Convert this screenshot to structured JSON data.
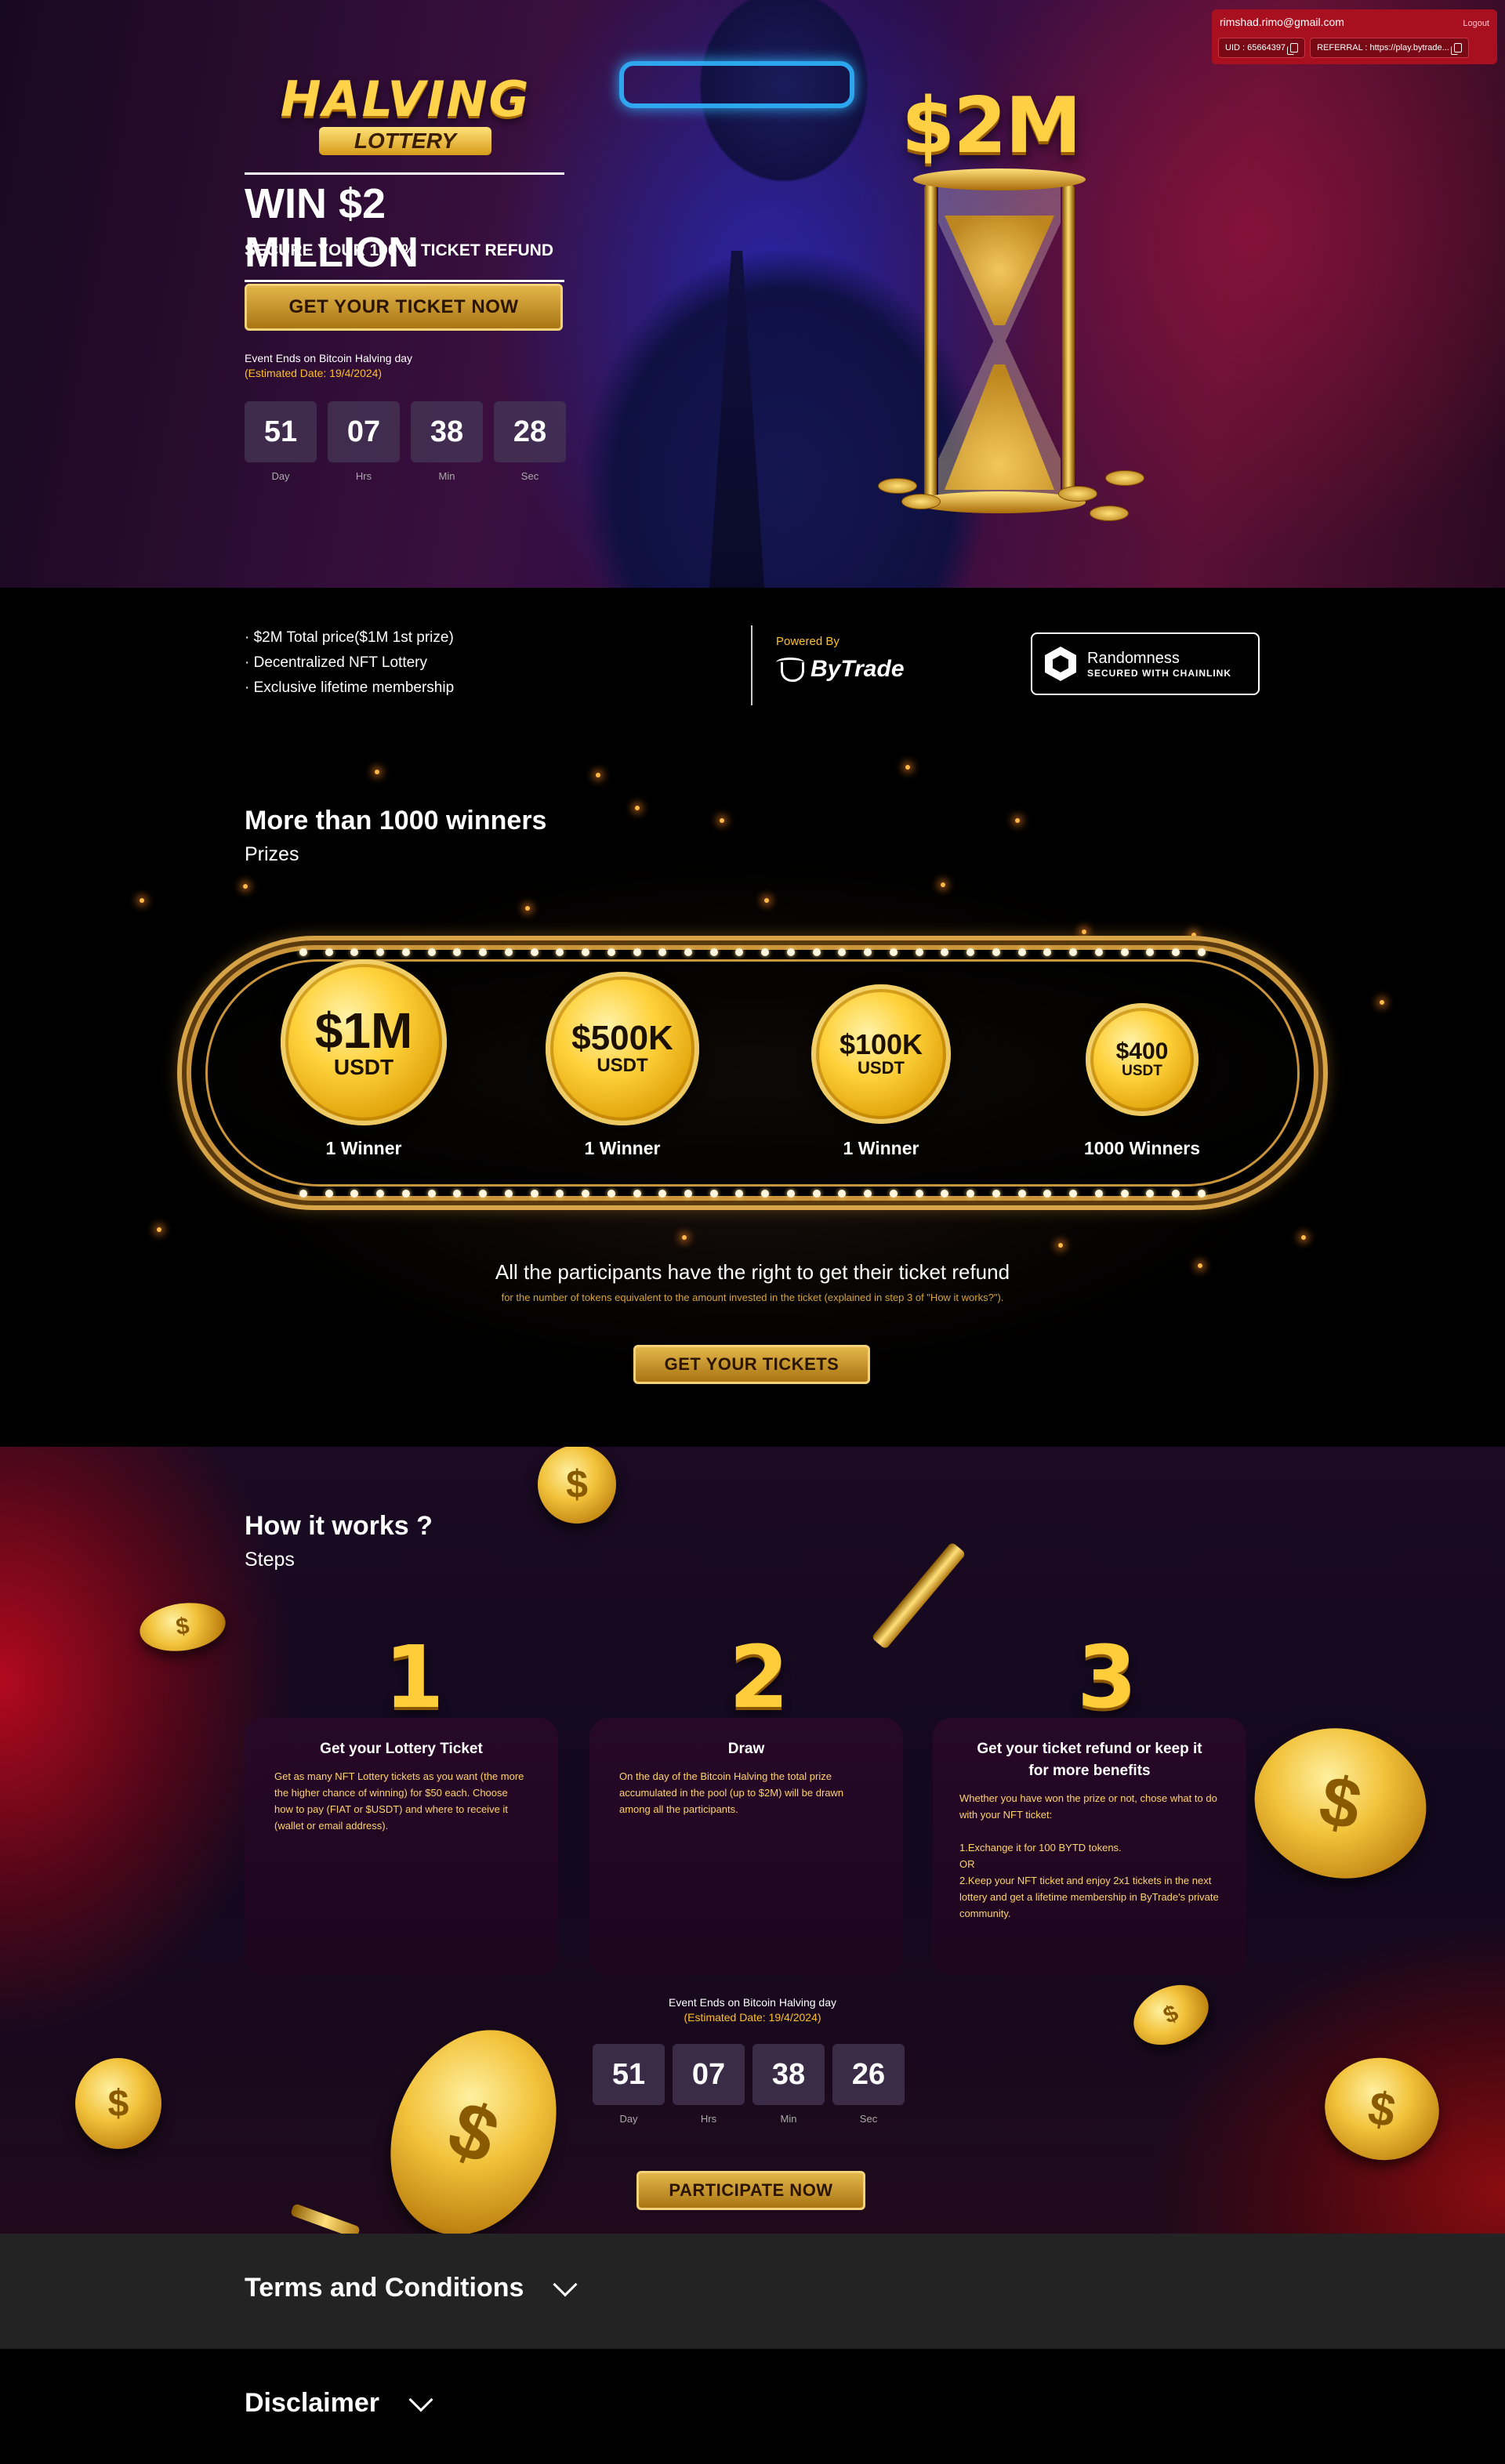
{
  "user": {
    "email": "rimshad.rimo@gmail.com",
    "logout": "Logout",
    "uid": "UID : 65664397",
    "referral": "REFERRAL : https://play.bytrade..."
  },
  "hero": {
    "logo_top": "HALVING",
    "logo_bottom": "LOTTERY",
    "title": "WIN $2 MILLION",
    "subtitle": "SECURE YOUR 100 % TICKET REFUND",
    "cta": "GET YOUR TICKET NOW",
    "event_line1": "Event Ends on Bitcoin Halving day",
    "event_line2": "(Estimated Date: 19/4/2024)",
    "jackpot": "$2M",
    "countdown": [
      {
        "value": "51",
        "label": "Day"
      },
      {
        "value": "07",
        "label": "Hrs"
      },
      {
        "value": "38",
        "label": "Min"
      },
      {
        "value": "28",
        "label": "Sec"
      }
    ]
  },
  "info": {
    "bullets": [
      "$2M Total price($1M 1st prize)",
      "Decentralized NFT Lottery",
      "Exclusive lifetime membership"
    ],
    "powered_by": "Powered By",
    "brand": "ByTrade",
    "randomness_title": "Randomness",
    "randomness_sub": "SECURED WITH CHAINLINK"
  },
  "prizes": {
    "title": "More than 1000 winners",
    "subtitle": "Prizes",
    "items": [
      {
        "amount": "$1M",
        "currency": "USDT",
        "winners": "1 Winner"
      },
      {
        "amount": "$500K",
        "currency": "USDT",
        "winners": "1 Winner"
      },
      {
        "amount": "$100K",
        "currency": "USDT",
        "winners": "1 Winner"
      },
      {
        "amount": "$400",
        "currency": "USDT",
        "winners": "1000 Winners"
      }
    ],
    "refund_title": "All the participants have the right to get their ticket refund",
    "refund_sub": "for the number of tokens equivalent to the amount invested in the ticket (explained in step 3 of \"How it works?\").",
    "cta": "GET YOUR TICKETS"
  },
  "how": {
    "title": "How it works ?",
    "subtitle": "Steps",
    "steps": [
      {
        "num": "1",
        "title": "Get your Lottery Ticket",
        "body": "Get as many NFT Lottery tickets as you want (the more the higher chance of winning) for $50 each. Choose how to pay (FIAT or $USDT) and where to receive it (wallet or email address)."
      },
      {
        "num": "2",
        "title": "Draw",
        "body": "On the day of the Bitcoin Halving the total prize accumulated in the pool (up to $2M) will be drawn among all the participants."
      },
      {
        "num": "3",
        "title": "Get your ticket refund or keep it for more benefits",
        "body": "Whether you have won the prize or not, chose what to do with your NFT ticket:\n\n1.Exchange it for 100 BYTD tokens.\nOR\n2.Keep your NFT ticket and enjoy 2x1 tickets in the next lottery and get a lifetime membership in ByTrade's private community."
      }
    ],
    "event_line1": "Event Ends on Bitcoin Halving day",
    "event_line2": "(Estimated Date: 19/4/2024)",
    "countdown": [
      {
        "value": "51",
        "label": "Day"
      },
      {
        "value": "07",
        "label": "Hrs"
      },
      {
        "value": "38",
        "label": "Min"
      },
      {
        "value": "26",
        "label": "Sec"
      }
    ],
    "cta": "PARTICIPATE NOW"
  },
  "footer": {
    "terms": "Terms and Conditions",
    "disclaimer": "Disclaimer"
  },
  "icons": {
    "copy": "copy-icon",
    "chevron": "chevron-down-icon",
    "chainlink": "chainlink-hex-icon",
    "bull": "bytrade-bull-icon",
    "coin": "dollar-coin-icon"
  },
  "colors": {
    "gold": "#ffbf2a",
    "user_panel": "#a80f1f",
    "terms_bg": "#232323"
  }
}
